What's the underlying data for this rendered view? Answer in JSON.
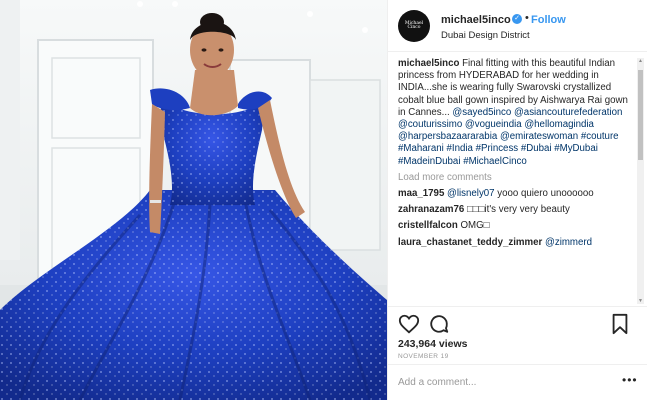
{
  "header": {
    "avatar_text": "Michael Cinco",
    "username": "michael5inco",
    "verified_glyph": "✓",
    "separator": "•",
    "follow_label": "Follow",
    "location": "Dubai Design District"
  },
  "caption": {
    "user": "michael5inco",
    "text": "Final fitting with this beautiful Indian princess from HYDERABAD for her wedding in INDIA...she is wearing fully Swarovski crystallized cobalt blue ball gown inspired by Aishwarya Rai gown in Cannes...",
    "tags": [
      "@sayed5inco",
      "@asiancouturefederation",
      "@couturissimo",
      "@vogueindia",
      "@hellomagindia",
      "@harpersbazaararabia",
      "@emirateswoman",
      "#couture",
      "#Maharani",
      "#India",
      "#Princess",
      "#Dubai",
      "#MyDubai",
      "#MadeinDubai",
      "#MichaelCinco"
    ]
  },
  "load_more_label": "Load more comments",
  "comments": [
    {
      "user": "maa_1795",
      "mention": "@lisnely07",
      "text": "yooo quiero unoooooo"
    },
    {
      "user": "zahranazam76",
      "text": "□□□it's very very beauty"
    },
    {
      "user": "cristellfalcon",
      "text": "OMG□"
    },
    {
      "user": "laura_chastanet_teddy_zimmer",
      "mention": "@zimmerd",
      "text": ""
    }
  ],
  "stats": {
    "views": "243,964 views",
    "date": "NOVEMBER 19"
  },
  "add_comment": {
    "placeholder": "Add a comment...",
    "more_glyph": "•••"
  },
  "icons": [
    "heart-icon",
    "comment-icon",
    "bookmark-icon",
    "verified-icon",
    "more-options-icon"
  ],
  "colors": {
    "link": "#003569",
    "follow": "#3897f0",
    "gown": "#1d3fc0"
  }
}
